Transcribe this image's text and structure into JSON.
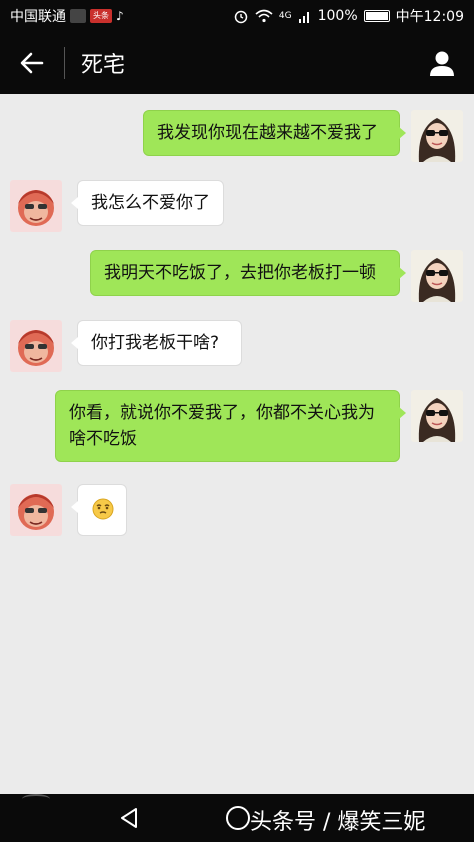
{
  "status_bar": {
    "carrier": "中国联通",
    "signal_label": "4G",
    "battery": "100%",
    "time": "中午12:09",
    "news_badge": "头条"
  },
  "header": {
    "title": "死宅"
  },
  "messages": [
    {
      "side": "out",
      "text": "我发现你现在越来越不爱我了"
    },
    {
      "side": "in",
      "text": "我怎么不爱你了"
    },
    {
      "side": "out",
      "text": "我明天不吃饭了，去把你老板打一顿"
    },
    {
      "side": "in",
      "text": "你打我老板干啥?"
    },
    {
      "side": "out",
      "text": "你看，就说你不爱我了，你都不关心我为啥不吃饭"
    },
    {
      "side": "in",
      "text": "",
      "emoji": "thinking-emoji"
    }
  ],
  "watermark": "头条号 / 爆笑三妮",
  "colors": {
    "bar_bg": "#0a0a0a",
    "chat_bg": "#ebebeb",
    "outgoing_bubble": "#9fe658",
    "incoming_bubble": "#ffffff"
  }
}
